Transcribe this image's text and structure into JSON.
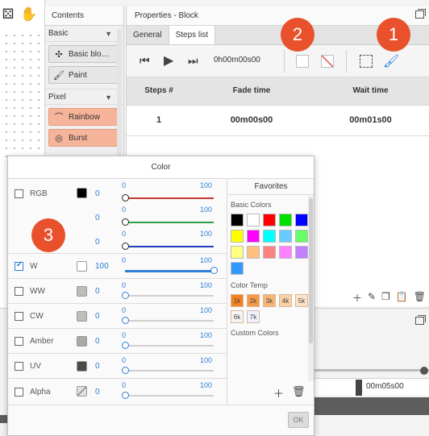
{
  "contents": {
    "title": "Contents",
    "categories": [
      {
        "label": "Basic",
        "items": [
          "Basic blo…",
          "Paint"
        ]
      },
      {
        "label": "Pixel",
        "items": [
          "Rainbow",
          "Burst"
        ]
      }
    ]
  },
  "properties": {
    "title": "Properties - Block",
    "tabs": [
      "General",
      "Steps list"
    ],
    "active_tab": "Steps list",
    "timecode": "0h00m00s00",
    "table": {
      "headers": [
        "Steps #",
        "Fade time",
        "Wait time"
      ],
      "rows": [
        [
          "1",
          "00m00s00",
          "00m01s00"
        ]
      ]
    }
  },
  "timeline": {
    "time_label": "00m05s00"
  },
  "color_dialog": {
    "title": "Color",
    "channels": [
      {
        "label": "RGB",
        "checked": false,
        "value": "0",
        "min": "0",
        "max": "100",
        "swatch": "#000000",
        "rgb_values": [
          "0",
          "0",
          "0"
        ]
      },
      {
        "label": "W",
        "checked": true,
        "value": "100",
        "min": "0",
        "max": "100",
        "swatch": "#ffffff"
      },
      {
        "label": "WW",
        "checked": false,
        "value": "0",
        "min": "0",
        "max": "100",
        "swatch": "#bdbdbd"
      },
      {
        "label": "CW",
        "checked": false,
        "value": "0",
        "min": "0",
        "max": "100",
        "swatch": "#bdbdbd"
      },
      {
        "label": "Amber",
        "checked": false,
        "value": "0",
        "min": "0",
        "max": "100",
        "swatch": "#a9a9a9"
      },
      {
        "label": "UV",
        "checked": false,
        "value": "0",
        "min": "0",
        "max": "100",
        "swatch": "#4a4a4a"
      },
      {
        "label": "Alpha",
        "checked": false,
        "value": "0",
        "min": "0",
        "max": "100",
        "swatch": "#d0d0d0"
      }
    ],
    "favorites": {
      "title": "Favorites",
      "basic_colors_label": "Basic Colors",
      "basic_colors": [
        "#000000",
        "#ffffff",
        "#ff0000",
        "#00e000",
        "#0000ff",
        "#ffff00",
        "#ff00ff",
        "#00ffff",
        "#66ccff",
        "#66ff66",
        "#ffff80",
        "#ffc080",
        "#ff8080",
        "#ff80ff",
        "#c080ff",
        "#3399ff"
      ],
      "color_temp_label": "Color Temp",
      "color_temps": [
        {
          "label": "1k",
          "color": "#f58220"
        },
        {
          "label": "2k",
          "color": "#f79a45"
        },
        {
          "label": "3k",
          "color": "#f9b575"
        },
        {
          "label": "4k",
          "color": "#fbd0a6"
        },
        {
          "label": "5k",
          "color": "#fde2c8"
        },
        {
          "label": "6k",
          "color": "#f5f5f5"
        },
        {
          "label": "7k",
          "color": "#eef2ff"
        }
      ],
      "custom_colors_label": "Custom Colors"
    },
    "ok_label": "OK"
  },
  "badges": [
    "1",
    "2",
    "3"
  ]
}
